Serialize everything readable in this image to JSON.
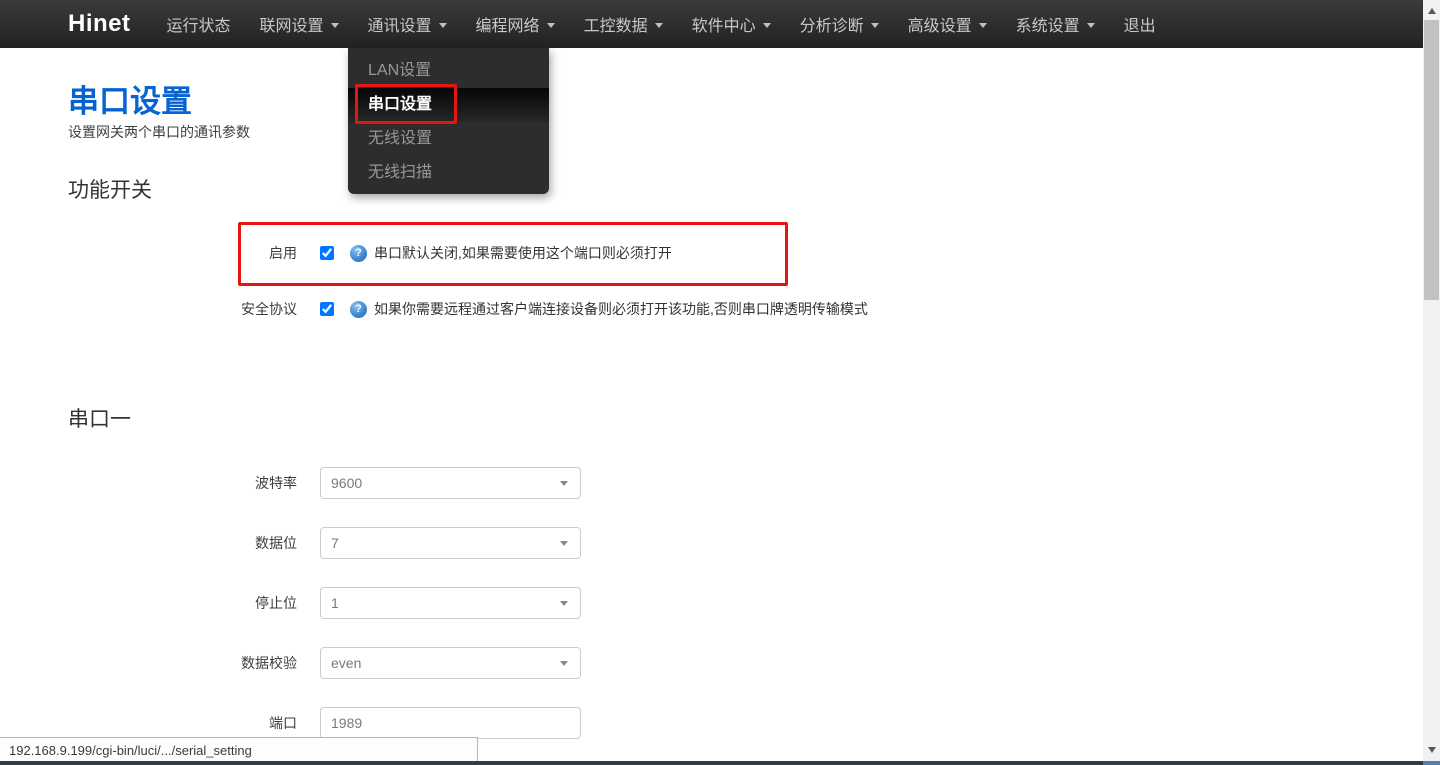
{
  "navbar": {
    "brand": "Hinet",
    "items": [
      {
        "label": "运行状态",
        "caret": false
      },
      {
        "label": "联网设置",
        "caret": true
      },
      {
        "label": "通讯设置",
        "caret": true
      },
      {
        "label": "编程网络",
        "caret": true
      },
      {
        "label": "工控数据",
        "caret": true
      },
      {
        "label": "软件中心",
        "caret": true
      },
      {
        "label": "分析诊断",
        "caret": true
      },
      {
        "label": "高级设置",
        "caret": true
      },
      {
        "label": "系统设置",
        "caret": true
      },
      {
        "label": "退出",
        "caret": false
      }
    ]
  },
  "dropdown": {
    "parent": "通讯设置",
    "items": [
      {
        "label": "LAN设置",
        "active": false
      },
      {
        "label": "串口设置",
        "active": true
      },
      {
        "label": "无线设置",
        "active": false
      },
      {
        "label": "无线扫描",
        "active": false
      }
    ]
  },
  "page": {
    "title": "串口设置",
    "subtitle": "设置网关两个串口的通讯参数"
  },
  "switch_section": {
    "heading": "功能开关",
    "rows": [
      {
        "label": "启用",
        "checked": true,
        "help": "串口默认关闭,如果需要使用这个端口则必须打开"
      },
      {
        "label": "安全协议",
        "checked": true,
        "help": "如果你需要远程通过客户端连接设备则必须打开该功能,否则串口牌透明传输模式"
      }
    ]
  },
  "serial_section": {
    "heading": "串口一",
    "fields": [
      {
        "label": "波特率",
        "value": "9600",
        "type": "select"
      },
      {
        "label": "数据位",
        "value": "7",
        "type": "select"
      },
      {
        "label": "停止位",
        "value": "1",
        "type": "select"
      },
      {
        "label": "数据校验",
        "value": "even",
        "type": "select"
      },
      {
        "label": "端口",
        "value": "1989",
        "type": "text"
      }
    ]
  },
  "statusbar": {
    "url": "192.168.9.199/cgi-bin/luci/.../serial_setting"
  },
  "icons": {
    "help_glyph": "?"
  },
  "colors": {
    "accent_blue": "#0663d2",
    "annotation_red": "#e61610",
    "navbar_bg": "#2b2b2b",
    "dropdown_active_bg": "#0a0a0a"
  }
}
